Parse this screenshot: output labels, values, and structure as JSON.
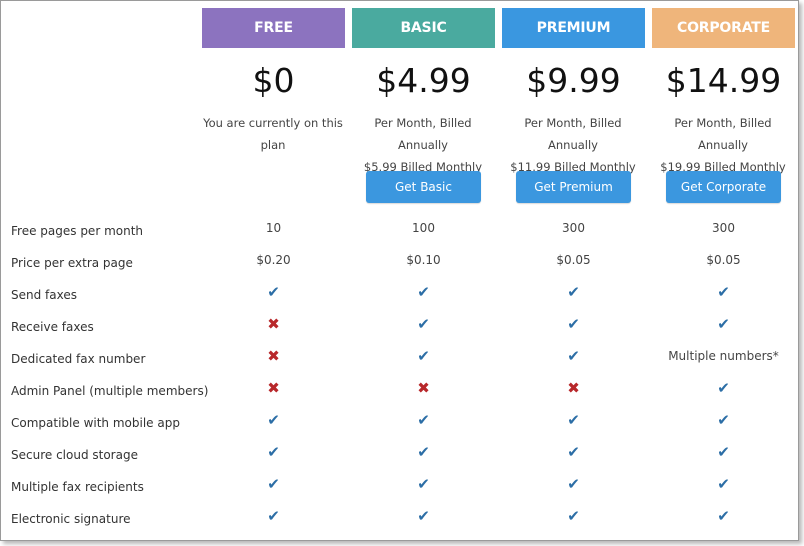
{
  "plans": [
    {
      "name": "FREE",
      "price": "$0",
      "line1": "You are currently on this",
      "line2": "plan",
      "button": null,
      "color": "#8c73bf"
    },
    {
      "name": "BASIC",
      "price": "$4.99",
      "line1": "Per Month, Billed Annually",
      "line2": "$5.99 Billed Monthly",
      "button": "Get Basic",
      "color": "#4aaa9f"
    },
    {
      "name": "PREMIUM",
      "price": "$9.99",
      "line1": "Per Month, Billed Annually",
      "line2": "$11.99 Billed Monthly",
      "button": "Get Premium",
      "color": "#3a97e0"
    },
    {
      "name": "CORPORATE",
      "price": "$14.99",
      "line1": "Per Month, Billed Annually",
      "line2": "$19.99 Billed Monthly",
      "button": "Get Corporate",
      "color": "#efb57b"
    }
  ],
  "features": [
    {
      "label": "Free pages per month",
      "values": [
        "10",
        "100",
        "300",
        "300"
      ]
    },
    {
      "label": "Price per extra page",
      "values": [
        "$0.20",
        "$0.10",
        "$0.05",
        "$0.05"
      ]
    },
    {
      "label": "Send faxes",
      "values": [
        "check",
        "check",
        "check",
        "check"
      ]
    },
    {
      "label": "Receive faxes",
      "values": [
        "cross",
        "check",
        "check",
        "check"
      ]
    },
    {
      "label": "Dedicated fax number",
      "values": [
        "cross",
        "check",
        "check",
        "Multiple numbers*"
      ]
    },
    {
      "label": "Admin Panel (multiple members)",
      "values": [
        "cross",
        "cross",
        "cross",
        "check"
      ]
    },
    {
      "label": "Compatible with mobile app",
      "values": [
        "check",
        "check",
        "check",
        "check"
      ]
    },
    {
      "label": "Secure cloud storage",
      "values": [
        "check",
        "check",
        "check",
        "check"
      ]
    },
    {
      "label": "Multiple fax recipients",
      "values": [
        "check",
        "check",
        "check",
        "check"
      ]
    },
    {
      "label": "Electronic signature",
      "values": [
        "check",
        "check",
        "check",
        "check"
      ]
    }
  ],
  "icons": {
    "check": "check-icon",
    "cross": "cross-icon"
  },
  "colors": {
    "button": "#3b97df",
    "check": "#2c6ea6",
    "cross": "#b8282b"
  }
}
